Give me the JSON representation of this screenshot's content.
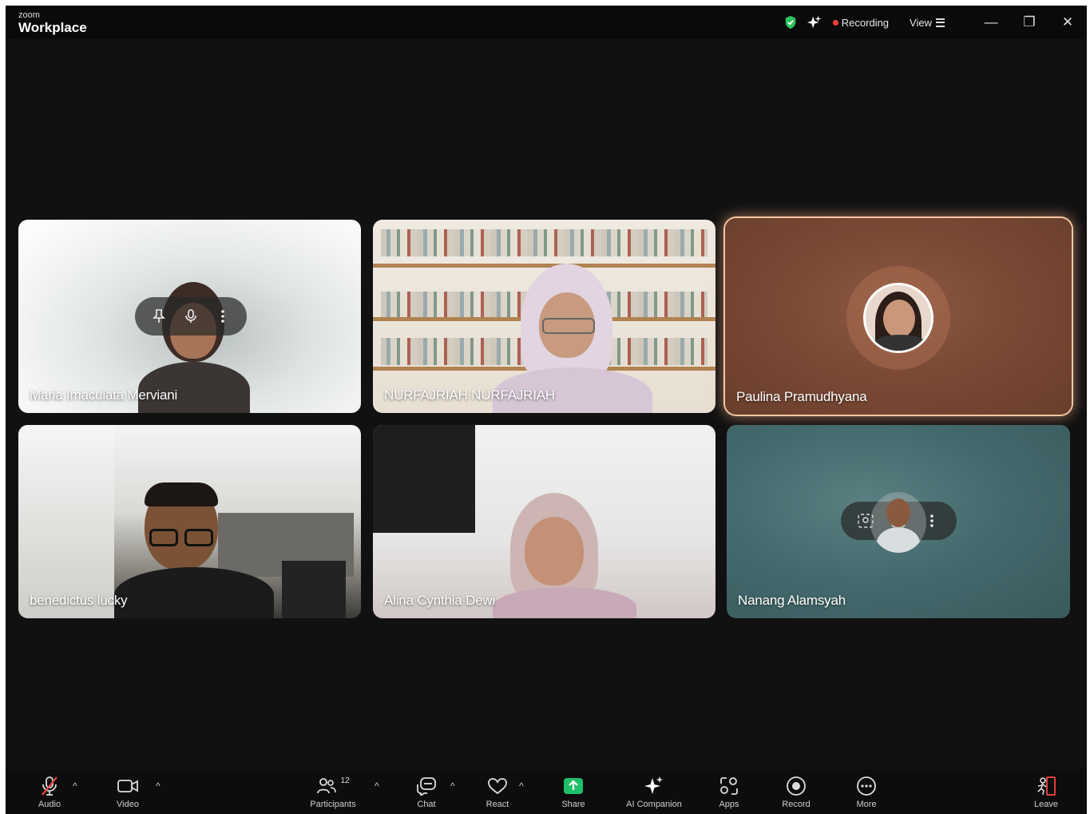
{
  "app": {
    "brand_small": "zoom",
    "brand_big": "Workplace"
  },
  "titlebar": {
    "recording_label": "Recording",
    "view_label": "View",
    "minimize": "—",
    "restore": "❐",
    "close": "✕"
  },
  "participants": [
    {
      "name": "Maria Imaculata Merviani"
    },
    {
      "name": "NURFAJRIAH NURFAJRIAH"
    },
    {
      "name": "Paulina Pramudhyana"
    },
    {
      "name": "benedictus lucky"
    },
    {
      "name": "Alina Cynthia Dewi"
    },
    {
      "name": "Nanang Alamsyah"
    }
  ],
  "toolbar": {
    "audio": "Audio",
    "video": "Video",
    "participants": "Participants",
    "participants_count": "12",
    "chat": "Chat",
    "react": "React",
    "share": "Share",
    "ai_companion": "AI Companion",
    "apps": "Apps",
    "record": "Record",
    "more": "More",
    "leave": "Leave"
  },
  "colors": {
    "share_green": "#1fbf6a",
    "recording_red": "#ff3b3b",
    "leave_red": "#e0413a",
    "active_speaker_glow": "#f4c6a4"
  }
}
